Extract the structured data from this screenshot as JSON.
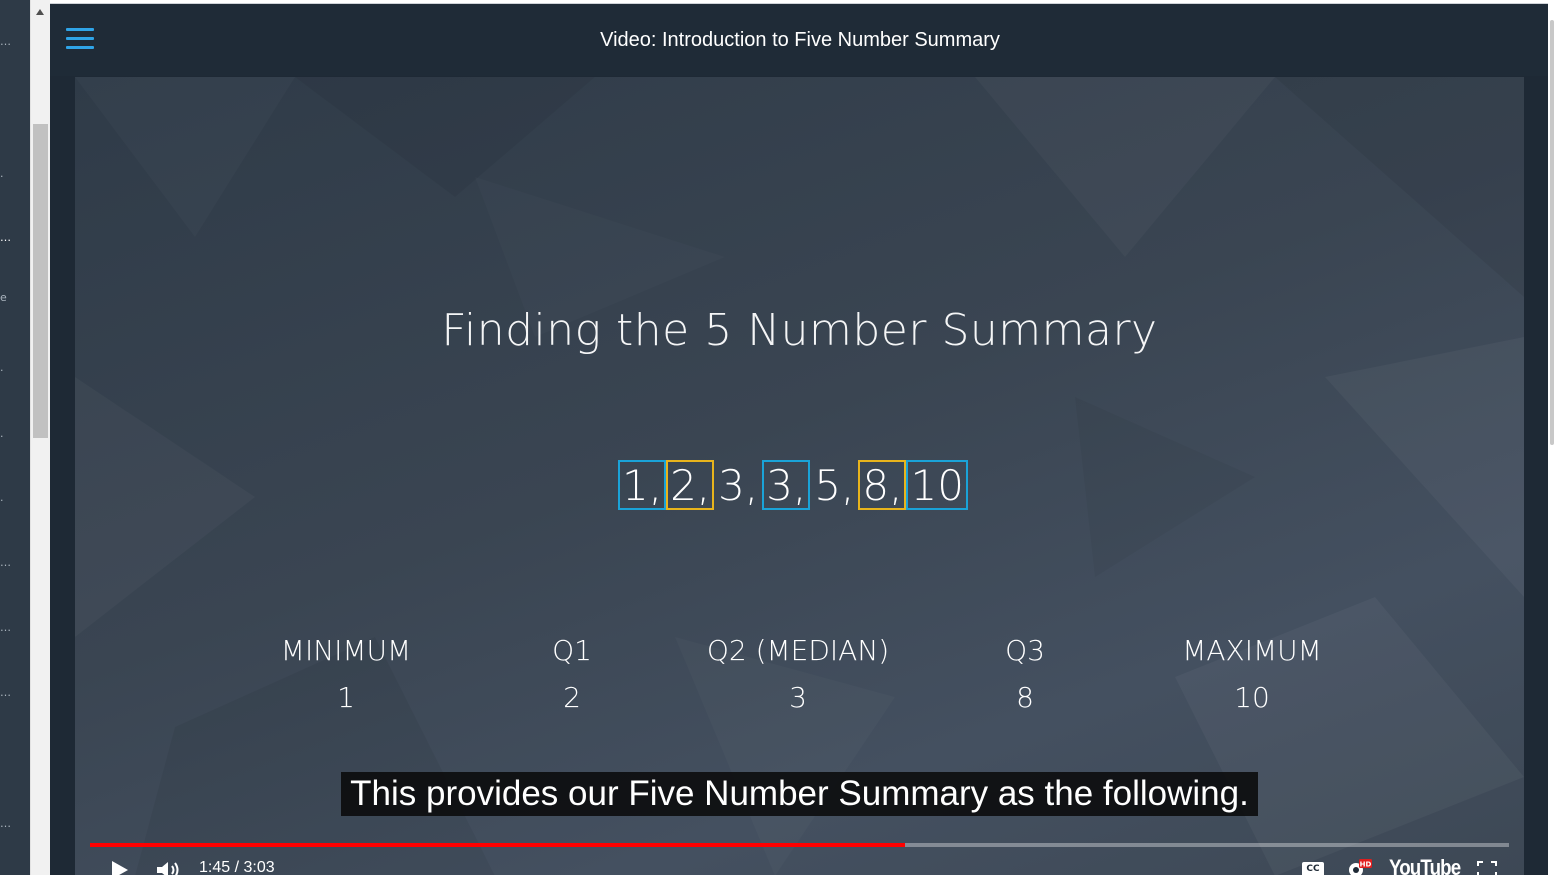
{
  "window": {
    "title": "Video: Introduction to Five Number Summary"
  },
  "slide": {
    "heading": "Finding the 5 Number Summary",
    "sequence": [
      {
        "text": "1,",
        "highlight": "blue"
      },
      {
        "text": "2,",
        "highlight": "yellow"
      },
      {
        "text": "3,",
        "highlight": "none"
      },
      {
        "text": "3,",
        "highlight": "blue"
      },
      {
        "text": "5,",
        "highlight": "none"
      },
      {
        "text": "8,",
        "highlight": "yellow"
      },
      {
        "text": "10",
        "highlight": "blue"
      }
    ],
    "stats": [
      {
        "label": "MINIMUM",
        "value": "1"
      },
      {
        "label": "Q1",
        "value": "2"
      },
      {
        "label": "Q2 (MEDIAN)",
        "value": "3"
      },
      {
        "label": "Q3",
        "value": "8"
      },
      {
        "label": "MAXIMUM",
        "value": "10"
      }
    ]
  },
  "caption": "This provides our Five Number Summary as the following.",
  "player": {
    "time_display": "1:45 / 3:03",
    "progress_fraction": 0.574,
    "cc_label": "CC",
    "hd_badge": "HD",
    "brand": "YouTube",
    "accent_color": "#ff0000"
  },
  "colors": {
    "highlight_blue": "#1aa3d8",
    "highlight_yellow": "#e8b41c",
    "menu_icon": "#2fa4e7"
  }
}
